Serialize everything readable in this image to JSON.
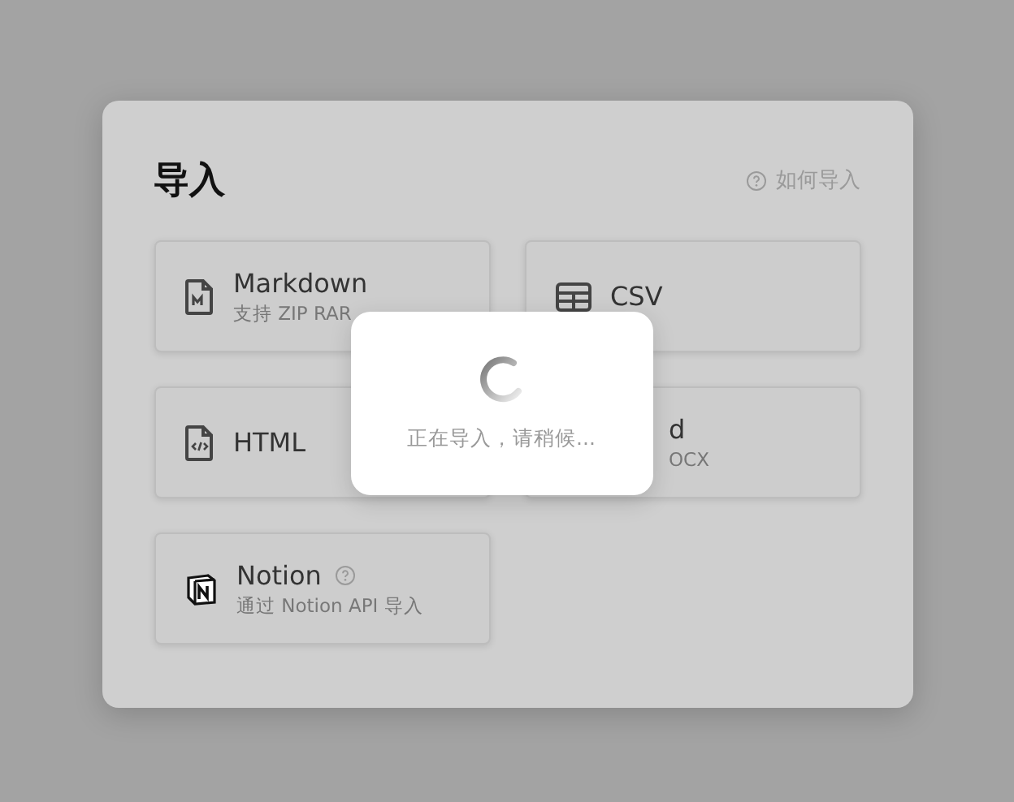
{
  "dialog": {
    "title": "导入",
    "help_link": "如何导入",
    "cards": [
      {
        "kind": "markdown",
        "title": "Markdown",
        "subtitle": "支持 ZIP RAR",
        "covered": false,
        "help": false
      },
      {
        "kind": "csv",
        "title": "CSV",
        "covered": false,
        "help": false
      },
      {
        "kind": "html",
        "title": "HTML",
        "covered": false,
        "help": false
      },
      {
        "kind": "word",
        "title": "d",
        "subtitle": "OCX",
        "covered": true,
        "help": false
      },
      {
        "kind": "notion",
        "title": "Notion",
        "subtitle": "通过 Notion API 导入",
        "covered": false,
        "help": true
      }
    ]
  },
  "loading": {
    "message": "正在导入，请稍候..."
  }
}
